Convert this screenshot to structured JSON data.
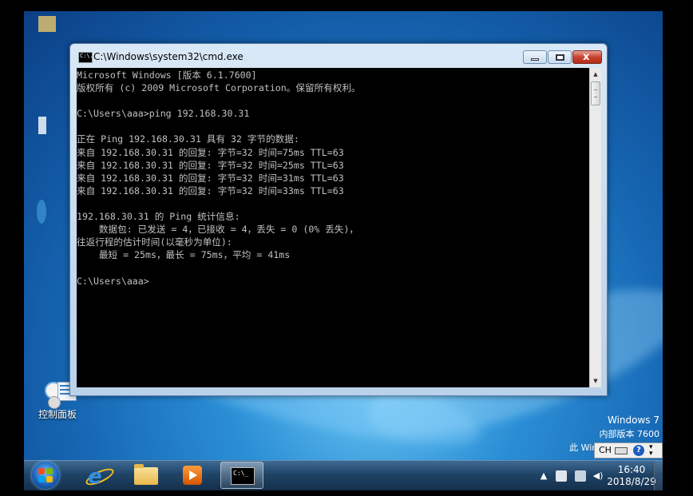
{
  "window": {
    "title": "C:\\Windows\\system32\\cmd.exe",
    "icon_text": "C:\\.",
    "buttons": [
      "minimize-icon",
      "maximize-icon",
      "close-icon"
    ]
  },
  "console": {
    "lines": [
      "Microsoft Windows [版本 6.1.7600]",
      "版权所有 (c) 2009 Microsoft Corporation。保留所有权利。",
      "",
      "C:\\Users\\aaa>ping 192.168.30.31",
      "",
      "正在 Ping 192.168.30.31 具有 32 字节的数据:",
      "来自 192.168.30.31 的回复: 字节=32 时间=75ms TTL=63",
      "来自 192.168.30.31 的回复: 字节=32 时间=25ms TTL=63",
      "来自 192.168.30.31 的回复: 字节=32 时间=31ms TTL=63",
      "来自 192.168.30.31 的回复: 字节=32 时间=33ms TTL=63",
      "",
      "192.168.30.31 的 Ping 统计信息:",
      "    数据包: 已发送 = 4，已接收 = 4，丢失 = 0 (0% 丢失)，",
      "往返行程的估计时间(以毫秒为单位):",
      "    最短 = 25ms，最长 = 75ms，平均 = 41ms",
      "",
      "C:\\Users\\aaa>"
    ]
  },
  "desktop": {
    "control_panel_label": "控制面板"
  },
  "watermark": {
    "line1": "Windows 7",
    "line2": "内部版本 7600",
    "line3": "此 Windo"
  },
  "language_bar": {
    "lang": "CH",
    "help": "?"
  },
  "taskbar": {
    "items": [
      "ie-icon",
      "explorer-icon",
      "media-player-icon",
      "cmd-icon"
    ],
    "cmd_icon_text": "C:\\_"
  },
  "clock": {
    "time": "16:40",
    "date": "2018/8/29"
  },
  "colors": {
    "console_bg": "#000000",
    "console_fg": "#c0c0c0",
    "taskbar": "#1f4467"
  }
}
